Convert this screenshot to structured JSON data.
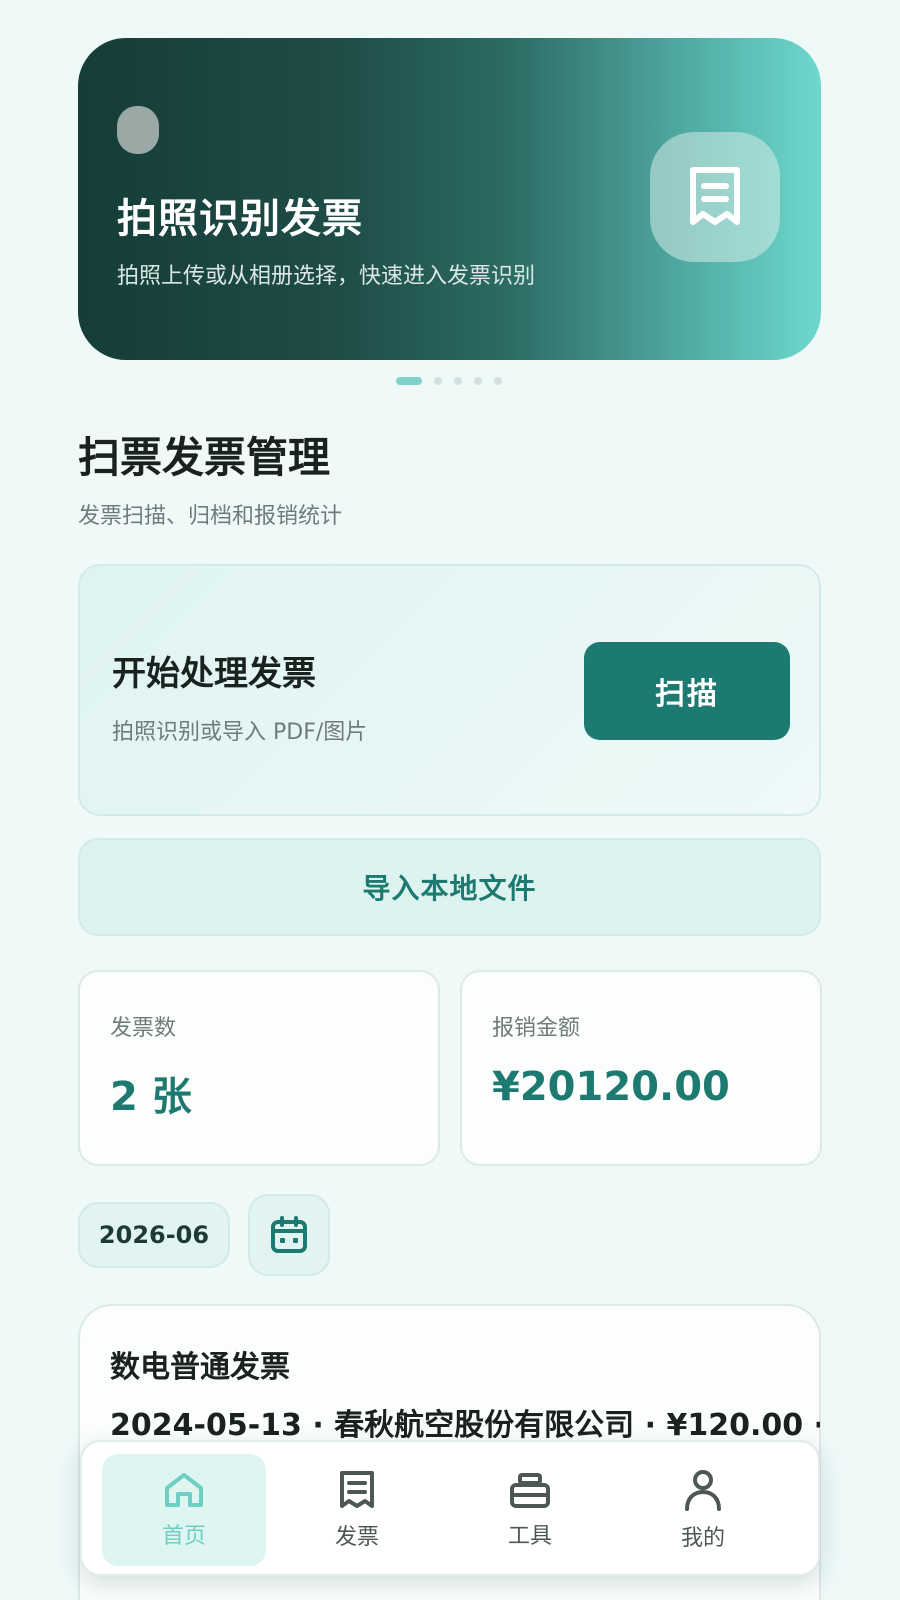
{
  "banner": {
    "title": "拍照识别发票",
    "subtitle": "拍照上传或从相册选择，快速进入发票识别",
    "icon": "receipt-icon",
    "pager_count": 5,
    "pager_active_index": 0
  },
  "header": {
    "title": "扫票发票管理",
    "subtitle": "发票扫描、归档和报销统计"
  },
  "start_card": {
    "title": "开始处理发票",
    "subtitle": "拍照识别或导入 PDF/图片",
    "scan_label": "扫描"
  },
  "import_label": "导入本地文件",
  "stats": {
    "count_label": "发票数",
    "count_value": "2 张",
    "amount_label": "报销金额",
    "amount_value": "¥20120.00"
  },
  "filter": {
    "month": "2026-06",
    "calendar_icon": "calendar-icon"
  },
  "invoices": [
    {
      "title": "数电普通发票",
      "meta": "2024-05-13 · 春秋航空股份有限公司 · ¥120.00 ·"
    }
  ],
  "tabbar": {
    "items": [
      {
        "label": "首页",
        "icon": "home-icon",
        "active": true
      },
      {
        "label": "发票",
        "icon": "receipt-icon",
        "active": false
      },
      {
        "label": "工具",
        "icon": "toolbox-icon",
        "active": false
      },
      {
        "label": "我的",
        "icon": "user-icon",
        "active": false
      }
    ]
  },
  "colors": {
    "accent": "#1d7a70",
    "accent_light": "#6fcfc2",
    "background": "#eef9f8"
  }
}
